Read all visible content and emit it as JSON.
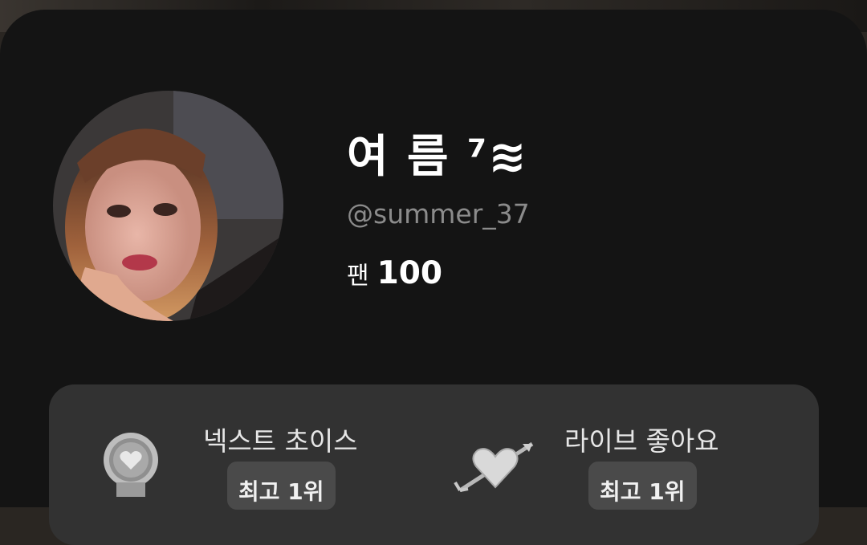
{
  "profile": {
    "display_name": "여 름 ⁷≋",
    "handle": "@summer_37",
    "fans_label": "팬",
    "fans_count": "100",
    "avatar_icon": "profile-photo"
  },
  "badges": [
    {
      "title": "넥스트 초이스",
      "rank": "최고 1위",
      "icon": "heart-medal-icon"
    },
    {
      "title": "라이브 좋아요",
      "rank": "최고 1위",
      "icon": "heart-arrow-icon"
    }
  ],
  "colors": {
    "sheet_bg": "#141414",
    "panel_bg": "#323232",
    "handle_text": "#8b8b8b",
    "primary_text": "#ffffff"
  }
}
